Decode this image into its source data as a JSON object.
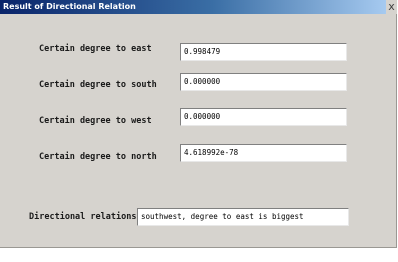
{
  "window": {
    "title": "Result of Directional Relation",
    "close_glyph": "x"
  },
  "fields": {
    "east": {
      "label": "Certain degree to east",
      "value": "0.998479"
    },
    "south": {
      "label": "Certain degree to south",
      "value": "0.000000"
    },
    "west": {
      "label": "Certain degree to west",
      "value": "0.000000"
    },
    "north": {
      "label": "Certain degree to north",
      "value": "4.618992e-78"
    },
    "relations": {
      "label": "Directional relations",
      "value": "southwest, degree to east is biggest"
    }
  }
}
